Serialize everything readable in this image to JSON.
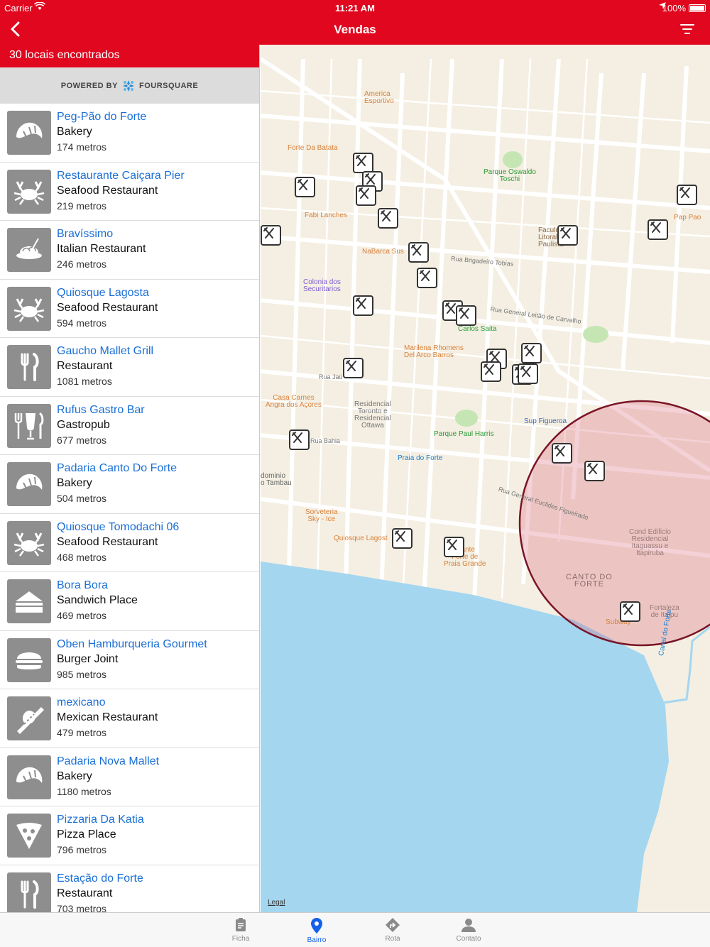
{
  "status_bar": {
    "carrier": "Carrier",
    "time": "11:21 AM",
    "battery": "100%"
  },
  "nav": {
    "title": "Vendas"
  },
  "left": {
    "count_label": "30 locais encontrados",
    "powered_by": "POWERED BY",
    "brand": "FOURSQUARE"
  },
  "places": [
    {
      "name": "Peg-Pão do Forte",
      "category": "Bakery",
      "distance": "174 metros",
      "icon": "croissant-icon"
    },
    {
      "name": "Restaurante Caiçara Pier",
      "category": "Seafood Restaurant",
      "distance": "219 metros",
      "icon": "crab-icon"
    },
    {
      "name": "Bravíssimo",
      "category": "Italian Restaurant",
      "distance": "246 metros",
      "icon": "pasta-icon"
    },
    {
      "name": "Quiosque Lagosta",
      "category": "Seafood Restaurant",
      "distance": "594 metros",
      "icon": "crab-icon"
    },
    {
      "name": "Gaucho Mallet Grill",
      "category": "Restaurant",
      "distance": "1081 metros",
      "icon": "fork-knife-icon"
    },
    {
      "name": "Rufus Gastro Bar",
      "category": "Gastropub",
      "distance": "677 metros",
      "icon": "glass-cutlery-icon"
    },
    {
      "name": "Padaria Canto Do Forte",
      "category": "Bakery",
      "distance": "504 metros",
      "icon": "croissant-icon"
    },
    {
      "name": "Quiosque Tomodachi 06",
      "category": "Seafood Restaurant",
      "distance": "468 metros",
      "icon": "crab-icon"
    },
    {
      "name": "Bora Bora",
      "category": "Sandwich Place",
      "distance": "469 metros",
      "icon": "sandwich-icon"
    },
    {
      "name": "Oben Hamburqueria Gourmet",
      "category": "Burger Joint",
      "distance": "985 metros",
      "icon": "burger-icon"
    },
    {
      "name": "mexicano",
      "category": "Mexican Restaurant",
      "distance": "479 metros",
      "icon": "sombrero-icon"
    },
    {
      "name": "Padaria Nova Mallet",
      "category": "Bakery",
      "distance": "1180 metros",
      "icon": "croissant-icon"
    },
    {
      "name": "Pizzaria Da Katia",
      "category": "Pizza Place",
      "distance": "796 metros",
      "icon": "pizza-icon"
    },
    {
      "name": "Estação do Forte",
      "category": "Restaurant",
      "distance": "703 metros",
      "icon": "fork-knife-icon"
    }
  ],
  "map": {
    "legal": "Legal",
    "labels": {
      "america": "America\nEsportivo",
      "forte_batata": "Forte Da Batata",
      "parque_oswaldo": "Parque Oswaldo\nToschi",
      "fabi": "Fabi Lanches",
      "faculdade": "Faculdade\nLitoral Sul\nPaulista",
      "pap_pao": "Pap Pao",
      "nabarca": "NaBarca Sus",
      "colonia": "Colonia dos\nSecuritarios",
      "carlos_saita": "Carlos Saita",
      "marilena": "Marilena Rhomens\nDel Arco Barros",
      "casa_carnes": "Casa Carnes\nAngra dos Açores",
      "residencial": "Residencial\nToronto e\nResidencial\nOttawa",
      "sup_figueroa": "Sup Figueroa",
      "parque_paul": "Parque Paul Harris",
      "praia_forte": "Praia do Forte",
      "dominio": "dominio\no Tambau",
      "sorveteria": "Sorveteria\nSky - Ice",
      "quiosque_lagost": "Quiosque Lagost",
      "forte_praia": "urante\nForte de\nPraia Grande",
      "cond": "Cond Edificio\nResidencial\nItaguassu e\nItapiruba",
      "canto_forte": "CANTO DO\nFORTE",
      "fortaleza": "Fortaleza\nde Itaipu",
      "subway": "Subway",
      "canal": "Canal do Forte",
      "rua_jau": "Rua Jaú",
      "rua_bahia": "Rua Bahia",
      "rua_tobias": "Rua Brigadeiro Tobias",
      "rua_leitao": "Rua General Leitão de Carvalho",
      "rua_euclides": "Rua General Euclides Figueirado"
    },
    "colors": {
      "land": "#f4efe2",
      "water": "#a4d6f0",
      "circle": "#7a1427"
    }
  },
  "tabs": [
    {
      "label": "Ficha",
      "icon": "clipboard-icon",
      "active": false
    },
    {
      "label": "Bairro",
      "icon": "location-pin-icon",
      "active": true
    },
    {
      "label": "Rota",
      "icon": "directions-icon",
      "active": false
    },
    {
      "label": "Contato",
      "icon": "person-icon",
      "active": false
    }
  ]
}
